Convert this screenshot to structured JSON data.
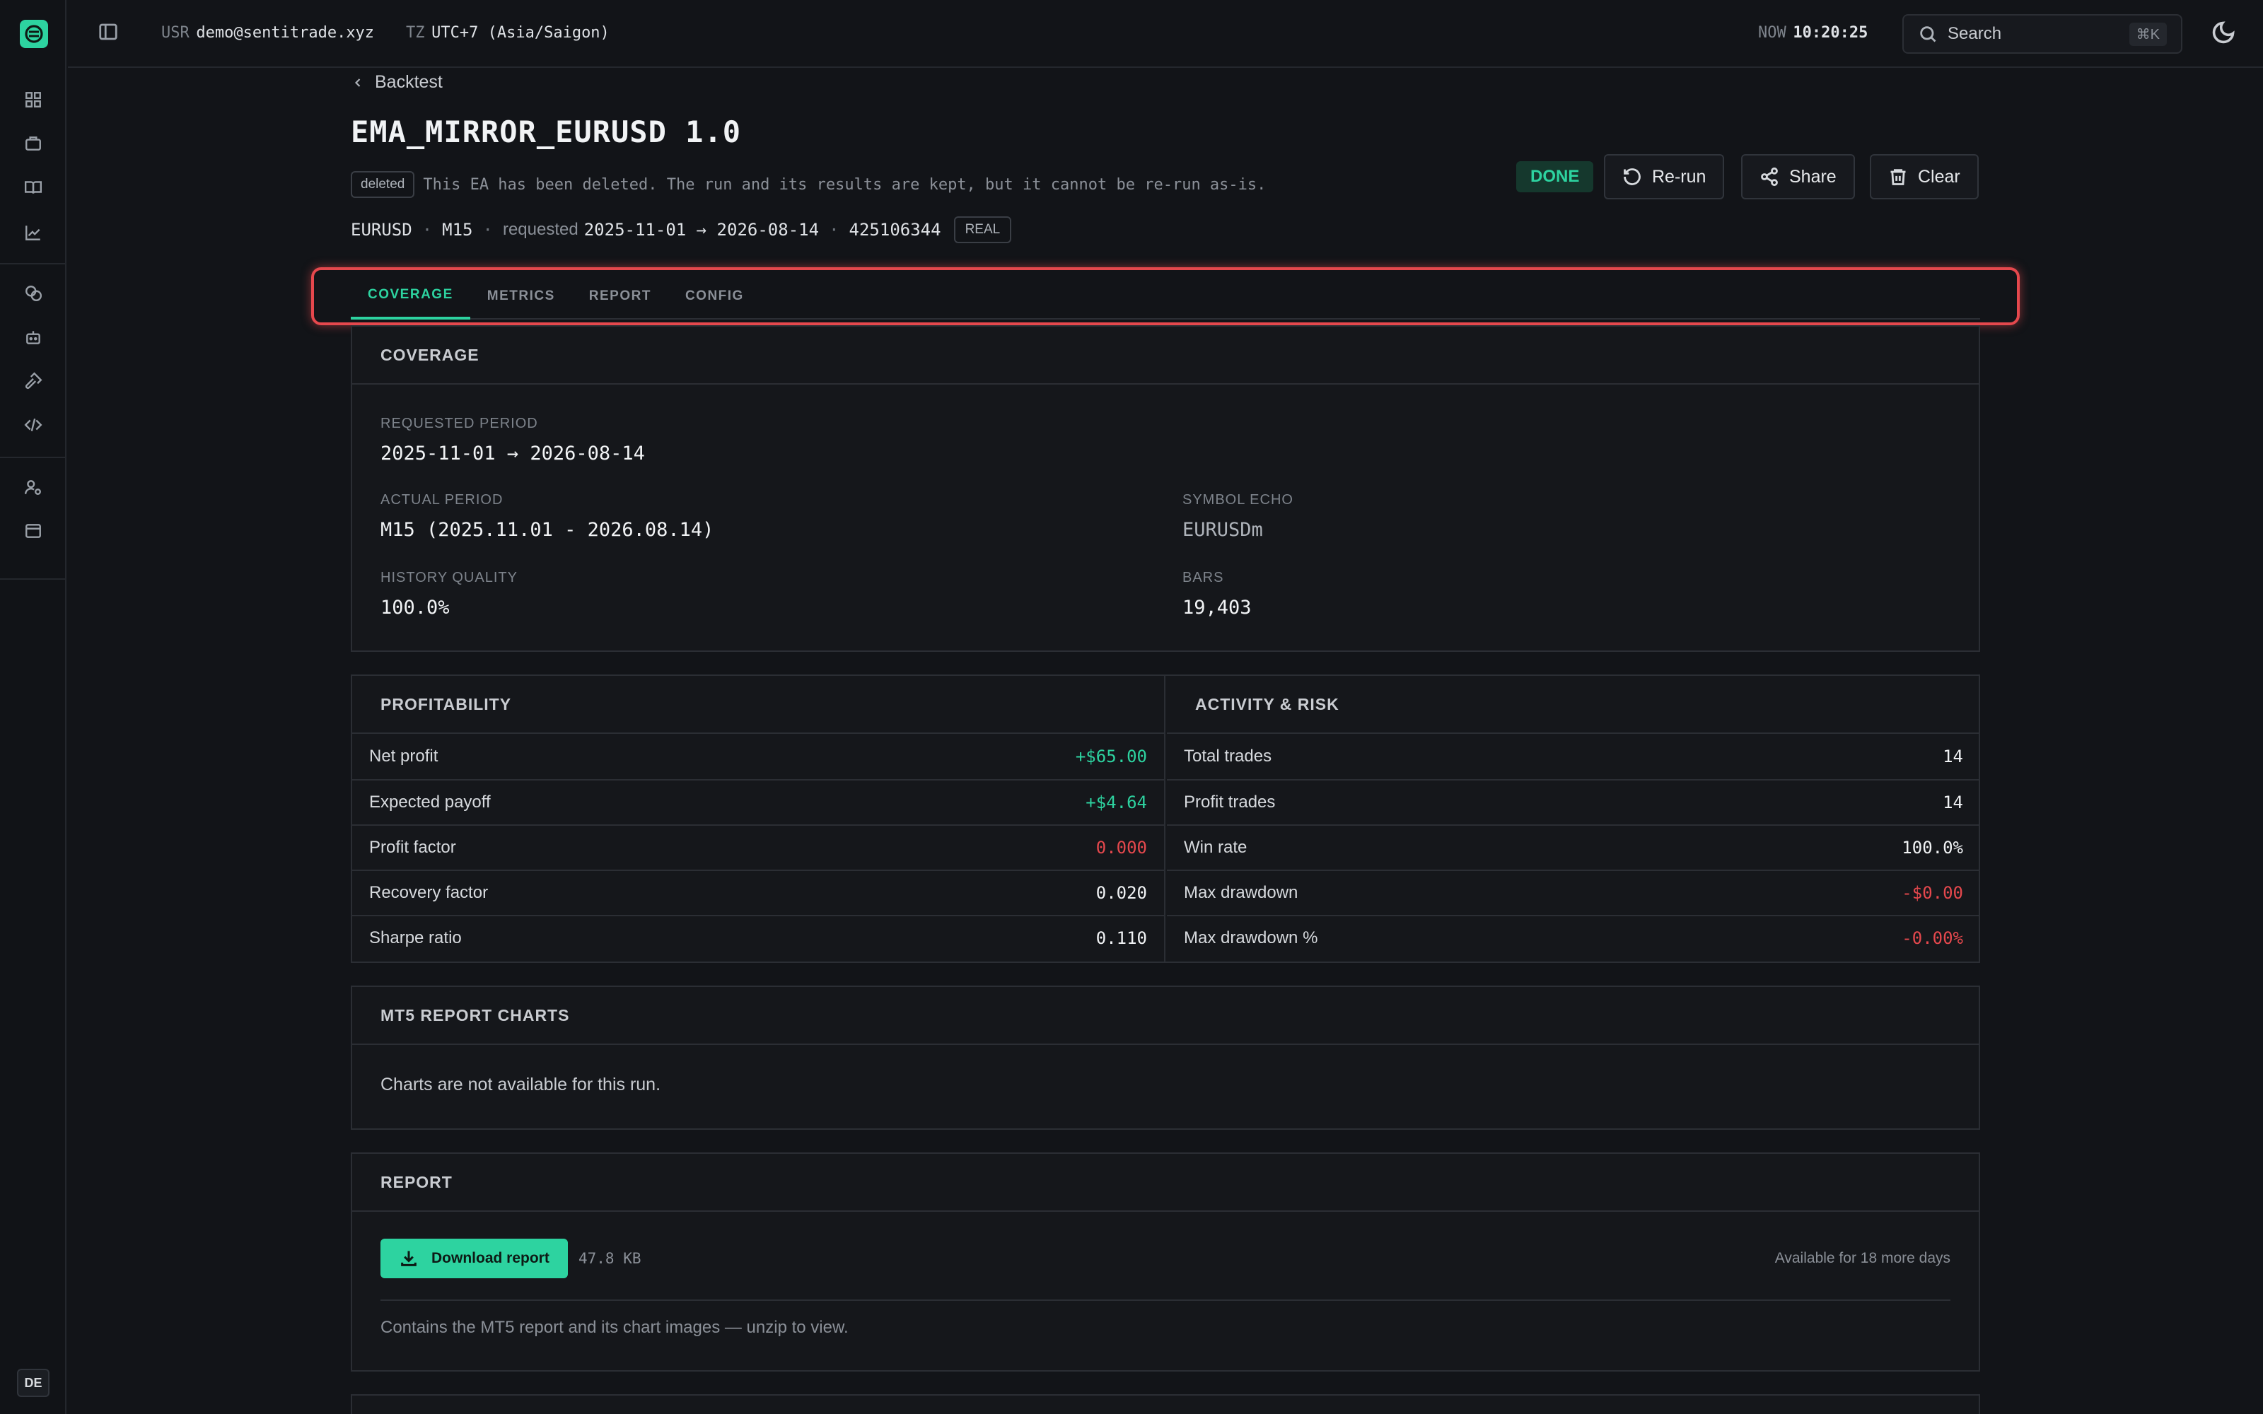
{
  "topbar": {
    "user_label": "USR",
    "user_value": "demo@sentitrade.xyz",
    "tz_label": "TZ",
    "tz_value": "UTC+7 (Asia/Saigon)",
    "now_label": "NOW",
    "now_value": "10:20:25",
    "search_placeholder": "Search",
    "search_shortcut": "⌘K"
  },
  "sidebar": {
    "icons": [
      "dashboard-icon",
      "briefcase-icon",
      "book-icon",
      "chart-line-icon",
      "coins-icon",
      "robot-icon",
      "hammer-icon",
      "code-icon",
      "user-cog-icon",
      "archive-icon"
    ],
    "lang": "DE"
  },
  "header": {
    "breadcrumb": "Backtest",
    "title": "EMA_MIRROR_EURUSD 1.0",
    "deleted_tag": "deleted",
    "notice": "This EA has been deleted. The run and its results are kept, but it cannot be re-run as-is.",
    "symbol": "EURUSD",
    "timeframe": "M15",
    "requested_label": "requested",
    "requested_range": "2025-11-01 → 2026-08-14",
    "account": "425106344",
    "account_type": "REAL",
    "status": "DONE",
    "rerun_label": "Re-run",
    "share_label": "Share",
    "clear_label": "Clear"
  },
  "tabs": [
    {
      "label": "COVERAGE",
      "active": true
    },
    {
      "label": "METRICS",
      "active": false
    },
    {
      "label": "REPORT",
      "active": false
    },
    {
      "label": "CONFIG",
      "active": false
    }
  ],
  "coverage": {
    "heading": "COVERAGE",
    "requested_period_label": "REQUESTED PERIOD",
    "requested_period": "2025-11-01 → 2026-08-14",
    "actual_period_label": "ACTUAL PERIOD",
    "actual_period": "M15 (2025.11.01 - 2026.08.14)",
    "symbol_echo_label": "SYMBOL ECHO",
    "symbol_echo": "EURUSDm",
    "history_quality_label": "HISTORY QUALITY",
    "history_quality": "100.0%",
    "bars_label": "BARS",
    "bars": "19,403"
  },
  "profitability": {
    "heading": "PROFITABILITY",
    "rows": [
      {
        "k": "Net profit",
        "v": "+$65.00",
        "tone": "pos"
      },
      {
        "k": "Expected payoff",
        "v": "+$4.64",
        "tone": "pos"
      },
      {
        "k": "Profit factor",
        "v": "0.000",
        "tone": "neg"
      },
      {
        "k": "Recovery factor",
        "v": "0.020",
        "tone": ""
      },
      {
        "k": "Sharpe ratio",
        "v": "0.110",
        "tone": ""
      }
    ]
  },
  "activity": {
    "heading": "ACTIVITY & RISK",
    "rows": [
      {
        "k": "Total trades",
        "v": "14",
        "tone": ""
      },
      {
        "k": "Profit trades",
        "v": "14",
        "tone": ""
      },
      {
        "k": "Win rate",
        "v": "100.0%",
        "tone": ""
      },
      {
        "k": "Max drawdown",
        "v": "-$0.00",
        "tone": "neg"
      },
      {
        "k": "Max drawdown %",
        "v": "-0.00%",
        "tone": "neg"
      }
    ]
  },
  "charts": {
    "heading": "MT5 REPORT CHARTS",
    "empty": "Charts are not available for this run."
  },
  "report": {
    "heading": "REPORT",
    "download_label": "Download report",
    "size": "47.8 KB",
    "availability": "Available for 18 more days",
    "note": "Contains the MT5 report and its chart images — unzip to view."
  },
  "colors": {
    "accent": "#2dd3a0",
    "negative": "#e5484d",
    "background": "#121418"
  }
}
